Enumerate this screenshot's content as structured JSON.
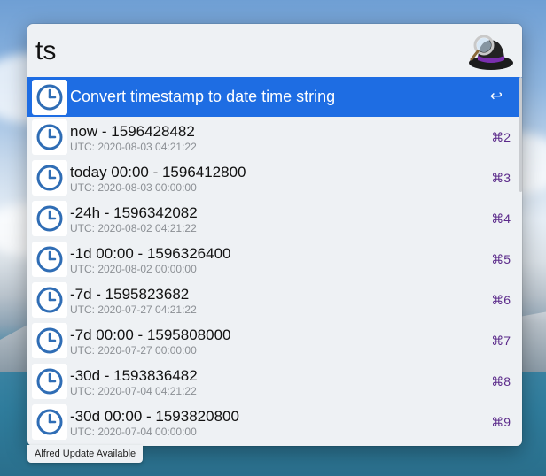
{
  "search": {
    "query": "ts"
  },
  "results": [
    {
      "title": "Convert timestamp to date time string",
      "subtitle": "",
      "shortcut": "↩",
      "selected": true
    },
    {
      "title": "now - 1596428482",
      "subtitle": "UTC: 2020-08-03 04:21:22",
      "shortcut": "⌘2"
    },
    {
      "title": "today 00:00 - 1596412800",
      "subtitle": "UTC: 2020-08-03 00:00:00",
      "shortcut": "⌘3"
    },
    {
      "title": "-24h - 1596342082",
      "subtitle": "UTC: 2020-08-02 04:21:22",
      "shortcut": "⌘4"
    },
    {
      "title": "-1d 00:00 - 1596326400",
      "subtitle": "UTC: 2020-08-02 00:00:00",
      "shortcut": "⌘5"
    },
    {
      "title": "-7d - 1595823682",
      "subtitle": "UTC: 2020-07-27 04:21:22",
      "shortcut": "⌘6"
    },
    {
      "title": "-7d 00:00 - 1595808000",
      "subtitle": "UTC: 2020-07-27 00:00:00",
      "shortcut": "⌘7"
    },
    {
      "title": "-30d - 1593836482",
      "subtitle": "UTC: 2020-07-04 04:21:22",
      "shortcut": "⌘8"
    },
    {
      "title": "-30d 00:00 - 1593820800",
      "subtitle": "UTC: 2020-07-04 00:00:00",
      "shortcut": "⌘9"
    }
  ],
  "icons": {
    "result_icon": "clock-icon",
    "app_icon": "alfred-hat-icon"
  },
  "colors": {
    "selection": "#1e6de3",
    "shortcut": "#5b2a8a",
    "clock": "#2f6db5"
  },
  "update_notice": "Alfred Update Available"
}
